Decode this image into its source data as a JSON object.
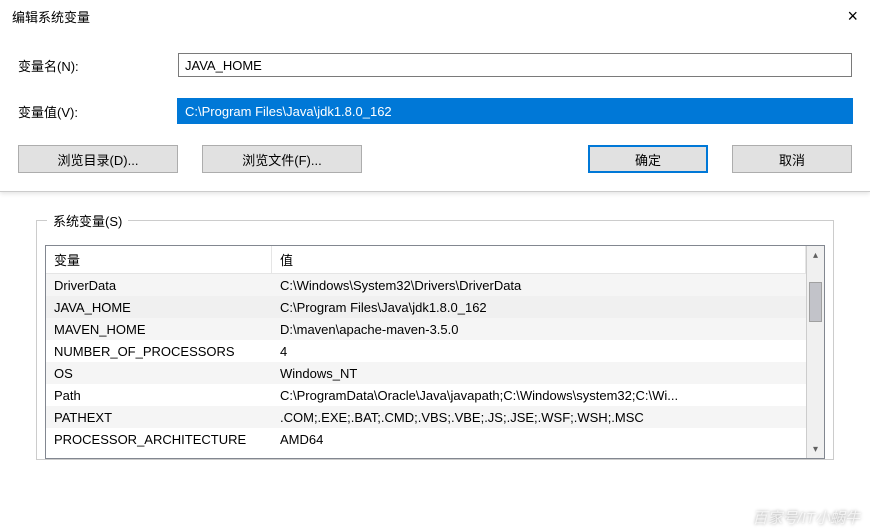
{
  "dialog": {
    "title": "编辑系统变量",
    "name_label": "变量名(N):",
    "name_value": "JAVA_HOME",
    "value_label": "变量值(V):",
    "value_value": "C:\\Program Files\\Java\\jdk1.8.0_162",
    "browse_dir": "浏览目录(D)...",
    "browse_file": "浏览文件(F)...",
    "ok": "确定",
    "cancel": "取消"
  },
  "sysvars": {
    "group_label": "系统变量(S)",
    "columns": {
      "var": "变量",
      "val": "值"
    },
    "rows": [
      {
        "var": "DriverData",
        "val": "C:\\Windows\\System32\\Drivers\\DriverData"
      },
      {
        "var": "JAVA_HOME",
        "val": "C:\\Program Files\\Java\\jdk1.8.0_162"
      },
      {
        "var": "MAVEN_HOME",
        "val": "D:\\maven\\apache-maven-3.5.0"
      },
      {
        "var": "NUMBER_OF_PROCESSORS",
        "val": "4"
      },
      {
        "var": "OS",
        "val": "Windows_NT"
      },
      {
        "var": "Path",
        "val": "C:\\ProgramData\\Oracle\\Java\\javapath;C:\\Windows\\system32;C:\\Wi..."
      },
      {
        "var": "PATHEXT",
        "val": ".COM;.EXE;.BAT;.CMD;.VBS;.VBE;.JS;.JSE;.WSF;.WSH;.MSC"
      },
      {
        "var": "PROCESSOR_ARCHITECTURE",
        "val": "AMD64"
      }
    ]
  },
  "watermark": "百家号/IT小蜗牛"
}
